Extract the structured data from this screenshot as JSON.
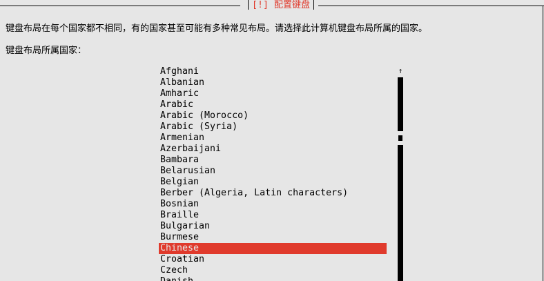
{
  "dialog": {
    "title_bracket": "[!]",
    "title": "配置键盘"
  },
  "description": "键盘布局在每个国家都不相同，有的国家甚至可能有多种常见布局。请选择此计算机键盘布局所属的国家。",
  "prompt": "键盘布局所属国家：",
  "list": {
    "items": [
      "Afghani",
      "Albanian",
      "Amharic",
      "Arabic",
      "Arabic (Morocco)",
      "Arabic (Syria)",
      "Armenian",
      "Azerbaijani",
      "Bambara",
      "Belarusian",
      "Belgian",
      "Berber (Algeria, Latin characters)",
      "Bosnian",
      "Braille",
      "Bulgarian",
      "Burmese",
      "Chinese",
      "Croatian",
      "Czech",
      "Danish"
    ],
    "selected": "Chinese"
  },
  "scrollbar": {
    "up_arrow": "↑"
  },
  "colors": {
    "background": "#e6e6e6",
    "accent": "#e03a2c",
    "text": "#000000"
  }
}
